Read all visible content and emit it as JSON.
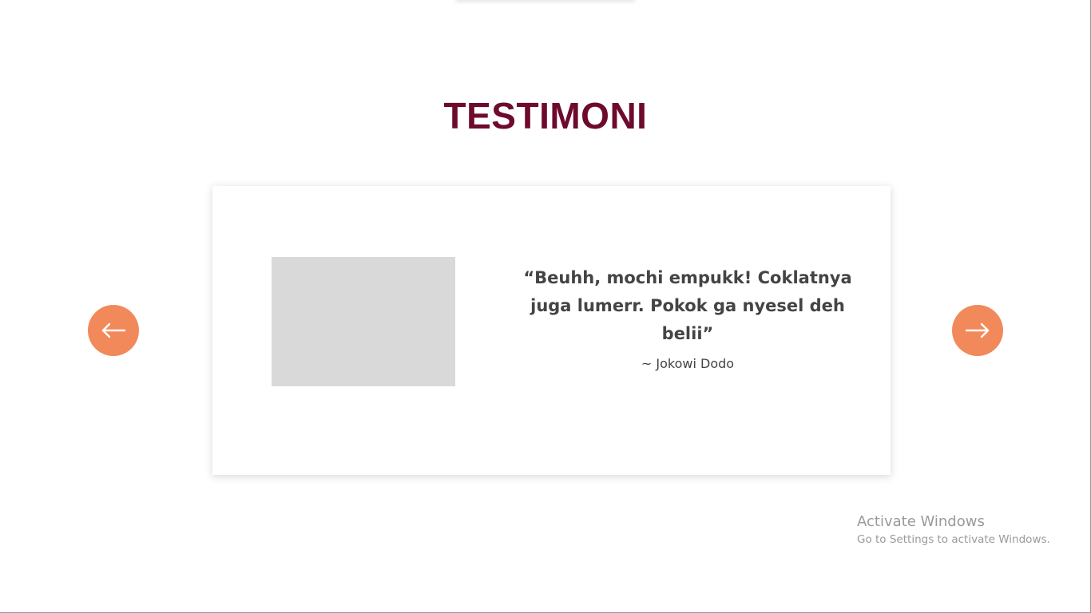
{
  "section": {
    "title": "TESTIMONI"
  },
  "testimonial": {
    "quote": "“Beuhh, mochi empukk! Coklatnya juga lumerr. Pokok ga nyesel deh belii”",
    "author": "~ Jokowi Dodo"
  },
  "carousel": {
    "prev_icon": "arrow-left-icon",
    "next_icon": "arrow-right-icon"
  },
  "colors": {
    "title": "#6e0a2e",
    "nav_button": "#f2895a",
    "text": "#444444",
    "photo_placeholder": "#d9d9d9"
  },
  "watermark": {
    "title": "Activate Windows",
    "subtitle": "Go to Settings to activate Windows."
  }
}
